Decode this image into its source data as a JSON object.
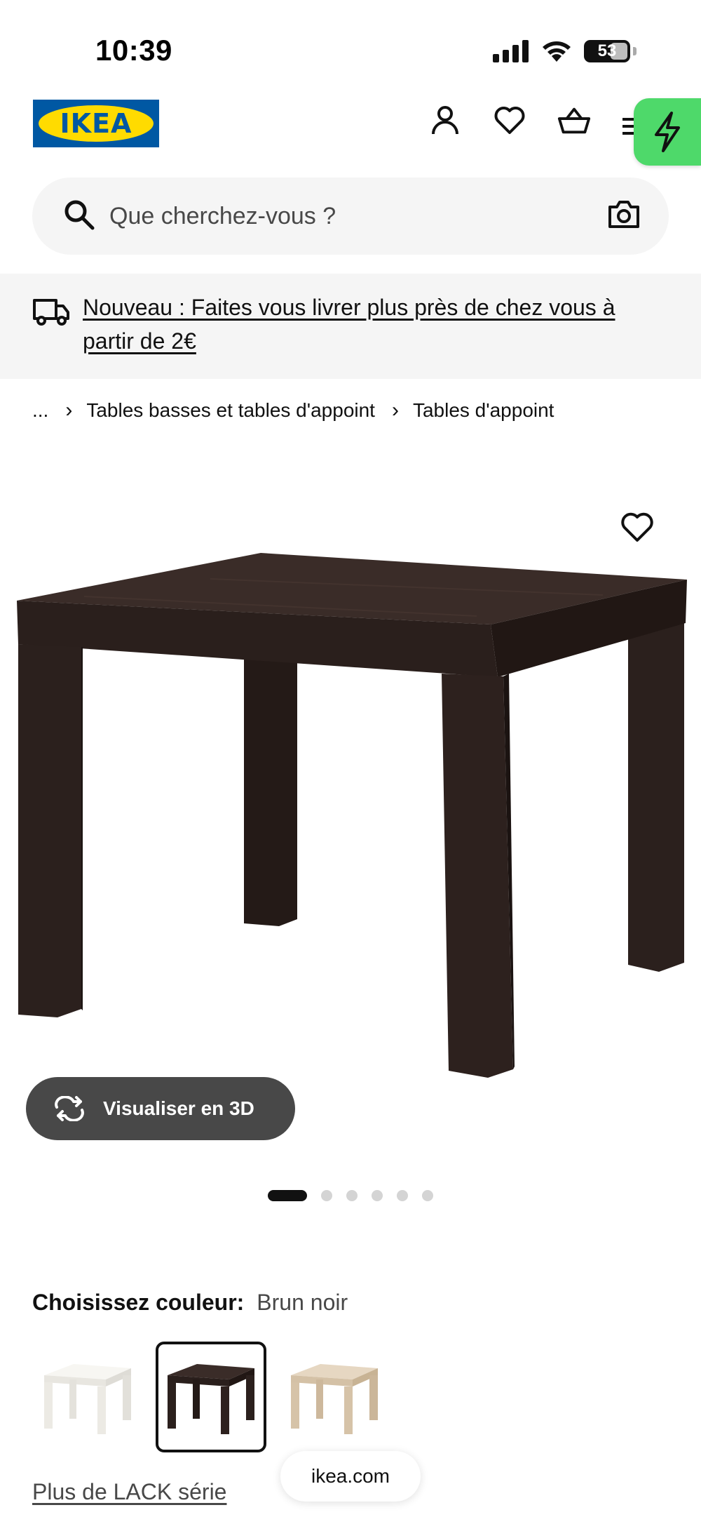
{
  "status_bar": {
    "time": "10:39",
    "battery": "53"
  },
  "header": {
    "logo_text": "IKEA"
  },
  "search": {
    "placeholder": "Que cherchez-vous ?"
  },
  "banner": {
    "text": "Nouveau : Faites vous livrer plus près de chez vous à partir de 2€"
  },
  "breadcrumb": {
    "ellipsis": "...",
    "items": [
      "Tables basses et tables d'appoint",
      "Tables d'appoint"
    ]
  },
  "product": {
    "view_3d_label": "Visualiser en 3D",
    "carousel": {
      "total": 6,
      "active": 1
    }
  },
  "color_choice": {
    "label": "Choisissez couleur:",
    "value": "Brun noir",
    "swatches": [
      {
        "name": "Blanc",
        "color": "#f4f3ef",
        "selected": false
      },
      {
        "name": "Brun noir",
        "color": "#2b1f1c",
        "selected": true
      },
      {
        "name": "Effet chêne",
        "color": "#d9c6ad",
        "selected": false
      }
    ]
  },
  "series_link": "Plus de LACK série",
  "browser": {
    "url": "ikea.com"
  },
  "colors": {
    "ikea_blue": "#0058a3",
    "ikea_yellow": "#ffdb00",
    "boost_green": "#4ed96a",
    "button_dark": "#484848"
  }
}
